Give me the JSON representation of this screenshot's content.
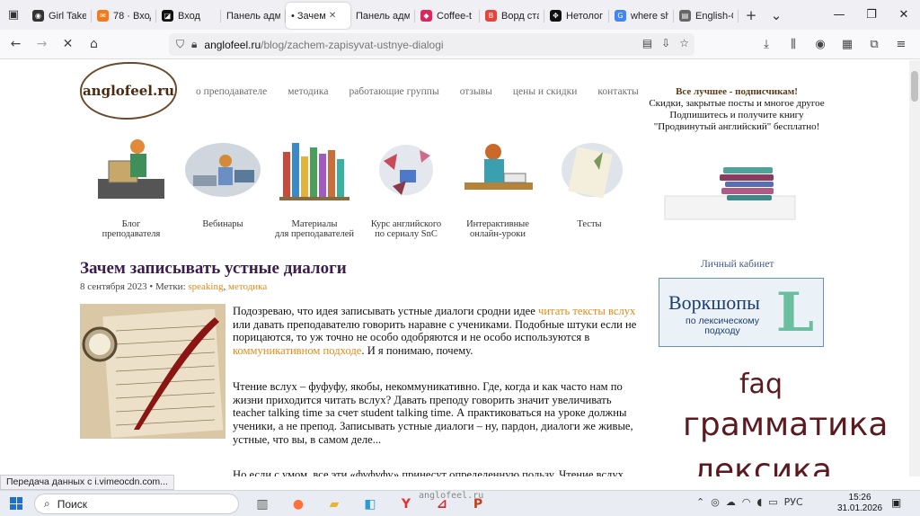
{
  "tabs": [
    {
      "label": "Girl Take",
      "color": "#333333",
      "glyph": "◉",
      "active": false
    },
    {
      "label": "78 · Вход",
      "color": "#f27a1a",
      "glyph": "✉",
      "active": false
    },
    {
      "label": "Вход",
      "color": "#111111",
      "glyph": "◪",
      "active": false
    },
    {
      "label": "Панель адм",
      "color": "",
      "glyph": "",
      "active": false
    },
    {
      "label": "• Зачем",
      "color": "",
      "glyph": "",
      "active": true
    },
    {
      "label": "Панель адм",
      "color": "",
      "glyph": "",
      "active": false
    },
    {
      "label": "Coffee-t",
      "color": "#e0245e",
      "glyph": "◆",
      "active": false
    },
    {
      "label": "Ворд ста",
      "color": "#e6443a",
      "glyph": "B",
      "active": false
    },
    {
      "label": "Нетолог",
      "color": "#111111",
      "glyph": "✥",
      "active": false
    },
    {
      "label": "where sh",
      "color": "#4285f4",
      "glyph": "G",
      "active": false
    },
    {
      "label": "English-C",
      "color": "#666666",
      "glyph": "▤",
      "active": false
    }
  ],
  "url": {
    "host": "anglofeel.ru",
    "path": "/blog/zachem-zapisyvat-ustnye-dialogi"
  },
  "site": {
    "logo": "anglofeel.ru",
    "nav": [
      "о преподавателе",
      "методика",
      "работающие группы",
      "отзывы",
      "цены и скидки",
      "контакты"
    ],
    "promo": {
      "title": "Все лучшее - подписчикам!",
      "line1": "Скидки, закрытые посты и многое другое",
      "line2": "Подпишитесь и получите книгу \"Продвинутый английский\" бесплатно!"
    },
    "categories": [
      {
        "label": "Блог\nпреподавателя"
      },
      {
        "label": "Вебинары"
      },
      {
        "label": "Материалы\nдля преподавателей"
      },
      {
        "label": "Курс английского\nпо сериалу SnC"
      },
      {
        "label": "Интерактивные\nонлайн-уроки"
      },
      {
        "label": "Тесты"
      }
    ]
  },
  "article": {
    "title": "Зачем записывать устные диалоги",
    "date_and_tags_prefix": "8 сентября 2023 • Метки:",
    "tag1": "speaking",
    "tag_sep": ",",
    "tag2": "методика",
    "p1_a": "Подозреваю, что идея записывать устные диалоги сродни идее",
    "p1_link1": "читать тексты вслух",
    "p1_b": "или давать преподавателю говорить наравне с учениками. Подобные штуки если не порицаются, то уж точно не особо одобряются и не особо используются в",
    "p1_link2": "коммуникативном подходе",
    "p1_c": ". И я понимаю, почему.",
    "p2": "Чтение вслух – фуфуфу, якобы, некоммуникативно. Где, когда и как часто нам по жизни приходится читать вслух? Давать преподу говорить значит увеличивать teacher talking time за счет student talking time. А практиковаться на уроке должны ученики, а не препод. Записывать устные диалоги – ну, пардон, диалоги же живые, устные, что вы, в самом деле...",
    "p3": "Но если с умом, все эти «фуфуфу» принесут определенную пользу. Чтение вслух"
  },
  "sidebar": {
    "cabinet": "Личный кабинет",
    "workshop_title": "Воркшопы",
    "workshop_sub": "по лексическому подходу",
    "workshop_letter": "L",
    "faq": "faq",
    "grammar": "грамматика",
    "lexis": "лексика"
  },
  "status": "Передача данных с i.vimeocdn.com...",
  "taskbar": {
    "search": "Поиск",
    "watermark": "anglofeel.ru",
    "lang": "РУС",
    "time": "15:26",
    "date": "31.01.2026"
  }
}
